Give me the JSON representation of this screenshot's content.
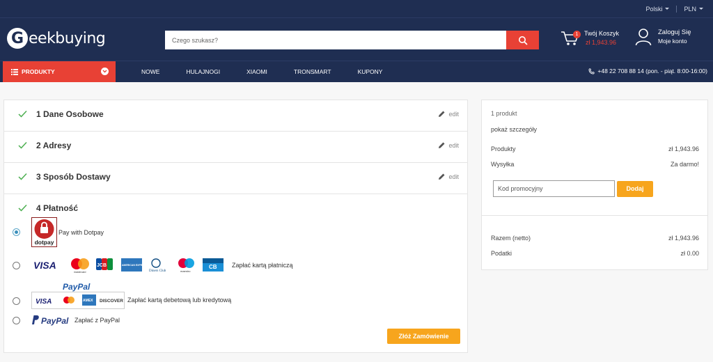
{
  "topbar": {
    "language": "Polski",
    "currency": "PLN"
  },
  "header": {
    "logo_letter": "G",
    "logo_text": "eekbuying",
    "search_placeholder": "Czego szukasz?",
    "cart_badge": "1",
    "cart_title": "Twój Koszyk",
    "cart_amount": "zł 1,943.96",
    "account_login": "Zaloguj Się",
    "account_sub": "Moje konto"
  },
  "nav": {
    "category_label": "PRODUKTY",
    "items": [
      "NOWE",
      "HULAJNOGI",
      "XIAOMI",
      "TRONSMART",
      "KUPONY"
    ],
    "phone": "+48 22 708 88 14 (pon. - piąt. 8:00-16:00)"
  },
  "checkout": {
    "steps": [
      {
        "title": "1 Dane Osobowe",
        "edit": "edit"
      },
      {
        "title": "2 Adresy",
        "edit": "edit"
      },
      {
        "title": "3 Sposób Dostawy",
        "edit": "edit"
      },
      {
        "title": "4 Płatność"
      }
    ],
    "payment_options": [
      {
        "label": "Pay with Dotpay",
        "selected": true,
        "logo_text": "dotpay"
      },
      {
        "label": "Zapłać kartą płatniczą",
        "selected": false,
        "logo_text": [
          "VISA",
          "JCB",
          "AMERICAN EXPRESS",
          "Diners Club",
          "maestro",
          "mastercard",
          "CB"
        ]
      },
      {
        "label": "Zapłać kartą debetową lub kredytową",
        "selected": false,
        "logo_text": [
          "PayPal",
          "VISA",
          "AMEX",
          "DISCOVER"
        ]
      },
      {
        "label": "Zapłać z PayPal",
        "selected": false,
        "logo_text": "PayPal"
      }
    ],
    "submit_label": "Złóż Zamówienie"
  },
  "summary": {
    "count": "1 produkt",
    "details_link": "pokaż szczegóły",
    "products_label": "Produkty",
    "products_value": "zł 1,943.96",
    "shipping_label": "Wysyłka",
    "shipping_value": "Za darmo!",
    "promo_placeholder": "Kod promocyjny",
    "promo_button": "Dodaj",
    "net_label": "Razem (netto)",
    "net_value": "zł 1,943.96",
    "tax_label": "Podatki",
    "tax_value": "zł 0.00"
  },
  "colors": {
    "navy": "#1f2e52",
    "red": "#e84135",
    "orange": "#f7a51d",
    "check": "#4caf50"
  }
}
